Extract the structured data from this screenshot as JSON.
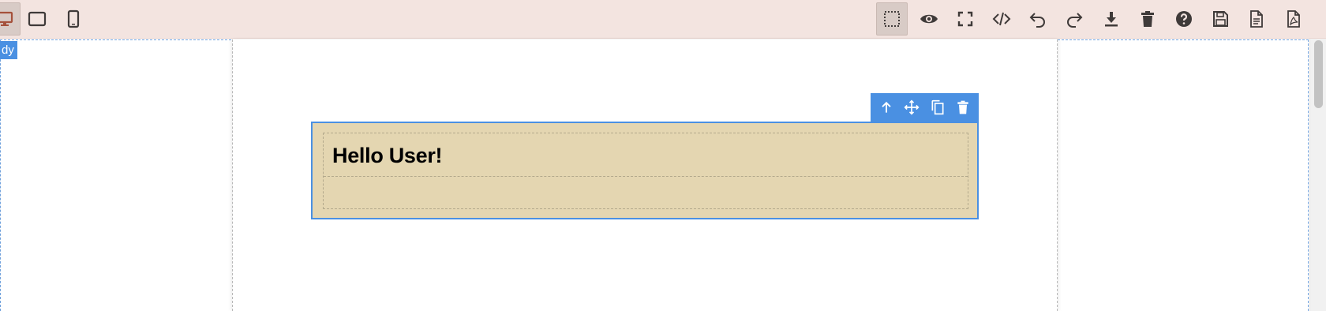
{
  "canvas": {
    "body_label": "dy",
    "heading": "Hello User!"
  },
  "colors": {
    "toolbar_bg": "#f3e4e0",
    "icon": "#3f3a39",
    "selection": "#4a90e2",
    "block_bg": "#e4d6b1"
  },
  "toolbar_left": [
    {
      "name": "desktop-icon",
      "active": true
    },
    {
      "name": "tablet-icon"
    },
    {
      "name": "mobile-icon"
    }
  ],
  "toolbar_right": [
    {
      "name": "select-outline-icon",
      "active": true
    },
    {
      "name": "preview-eye-icon"
    },
    {
      "name": "fullscreen-icon"
    },
    {
      "name": "code-icon"
    },
    {
      "name": "undo-icon"
    },
    {
      "name": "redo-icon"
    },
    {
      "name": "download-icon"
    },
    {
      "name": "trash-icon"
    },
    {
      "name": "help-icon"
    },
    {
      "name": "save-icon"
    },
    {
      "name": "document-icon"
    },
    {
      "name": "pdf-icon"
    }
  ],
  "element_toolbar": [
    {
      "name": "select-parent-icon"
    },
    {
      "name": "move-icon"
    },
    {
      "name": "clone-icon"
    },
    {
      "name": "delete-icon"
    }
  ]
}
